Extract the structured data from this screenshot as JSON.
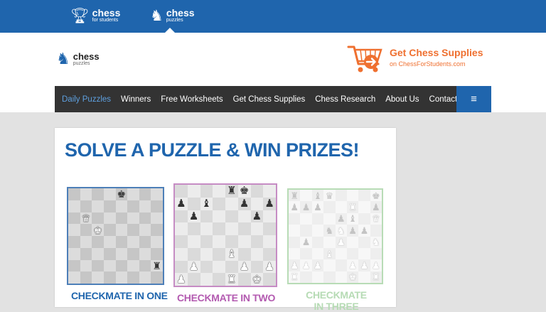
{
  "top_nav": {
    "items": [
      {
        "title": "chess",
        "subtitle": "for students",
        "icon": "trophy-icon"
      },
      {
        "title": "chess",
        "subtitle": "puzzles",
        "icon": "knight-icon"
      }
    ]
  },
  "logo": {
    "title": "chess",
    "subtitle": "puzzles"
  },
  "supplies": {
    "title": "Get Chess Supplies",
    "subtitle": "on ChessForStudents.com"
  },
  "main_nav": {
    "items": [
      "Daily Puzzles",
      "Winners",
      "Free Worksheets",
      "Get Chess Supplies",
      "Chess Research",
      "About Us",
      "Contact"
    ],
    "menu_icon": "≡"
  },
  "headline": "SOLVE A PUZZLE & WIN PRIZES!",
  "puzzles": [
    {
      "label": "CHECKMATE IN ONE",
      "pieces": [
        {
          "sq": "e8",
          "glyph": "♚",
          "color": "black"
        },
        {
          "sq": "b6",
          "glyph": "♛",
          "color": "white"
        },
        {
          "sq": "c5",
          "glyph": "♚",
          "color": "white"
        },
        {
          "sq": "h2",
          "glyph": "♜",
          "color": "black"
        }
      ]
    },
    {
      "label": "CHECKMATE IN TWO",
      "pieces": [
        {
          "sq": "e8",
          "glyph": "♜",
          "color": "black"
        },
        {
          "sq": "f8",
          "glyph": "♚",
          "color": "black"
        },
        {
          "sq": "a7",
          "glyph": "♟",
          "color": "black"
        },
        {
          "sq": "c7",
          "glyph": "♝",
          "color": "black"
        },
        {
          "sq": "f7",
          "glyph": "♟",
          "color": "black"
        },
        {
          "sq": "h7",
          "glyph": "♟",
          "color": "black"
        },
        {
          "sq": "b6",
          "glyph": "♟",
          "color": "black"
        },
        {
          "sq": "g6",
          "glyph": "♟",
          "color": "black"
        },
        {
          "sq": "e3",
          "glyph": "♝",
          "color": "white"
        },
        {
          "sq": "b2",
          "glyph": "♟",
          "color": "white"
        },
        {
          "sq": "f2",
          "glyph": "♟",
          "color": "white"
        },
        {
          "sq": "h2",
          "glyph": "♟",
          "color": "white"
        },
        {
          "sq": "a1",
          "glyph": "♟",
          "color": "white"
        },
        {
          "sq": "e1",
          "glyph": "♜",
          "color": "white"
        },
        {
          "sq": "g1",
          "glyph": "♚",
          "color": "white"
        }
      ]
    },
    {
      "label": "CHECKMATE IN THREE",
      "pieces": [
        {
          "sq": "a8",
          "glyph": "♜",
          "color": "black"
        },
        {
          "sq": "c8",
          "glyph": "♝",
          "color": "black"
        },
        {
          "sq": "d8",
          "glyph": "♛",
          "color": "black"
        },
        {
          "sq": "h8",
          "glyph": "♚",
          "color": "black"
        },
        {
          "sq": "a7",
          "glyph": "♟",
          "color": "black"
        },
        {
          "sq": "b7",
          "glyph": "♟",
          "color": "black"
        },
        {
          "sq": "c7",
          "glyph": "♟",
          "color": "black"
        },
        {
          "sq": "f7",
          "glyph": "♜",
          "color": "white"
        },
        {
          "sq": "h7",
          "glyph": "♟",
          "color": "black"
        },
        {
          "sq": "e6",
          "glyph": "♟",
          "color": "black"
        },
        {
          "sq": "f6",
          "glyph": "♝",
          "color": "black"
        },
        {
          "sq": "h6",
          "glyph": "♛",
          "color": "white"
        },
        {
          "sq": "d5",
          "glyph": "♞",
          "color": "black"
        },
        {
          "sq": "e5",
          "glyph": "♞",
          "color": "white"
        },
        {
          "sq": "f5",
          "glyph": "♟",
          "color": "black"
        },
        {
          "sq": "g5",
          "glyph": "♟",
          "color": "black"
        },
        {
          "sq": "b4",
          "glyph": "♟",
          "color": "black"
        },
        {
          "sq": "e4",
          "glyph": "♟",
          "color": "white"
        },
        {
          "sq": "h4",
          "glyph": "♞",
          "color": "white"
        },
        {
          "sq": "d3",
          "glyph": "♝",
          "color": "white"
        },
        {
          "sq": "c2",
          "glyph": "♟",
          "color": "white"
        },
        {
          "sq": "a2",
          "glyph": "♟",
          "color": "white"
        },
        {
          "sq": "b2",
          "glyph": "♟",
          "color": "white"
        },
        {
          "sq": "f2",
          "glyph": "♟",
          "color": "white"
        },
        {
          "sq": "g2",
          "glyph": "♟",
          "color": "white"
        },
        {
          "sq": "h2",
          "glyph": "♟",
          "color": "white"
        },
        {
          "sq": "a1",
          "glyph": "♜",
          "color": "white"
        },
        {
          "sq": "f1",
          "glyph": "♚",
          "color": "white"
        },
        {
          "sq": "h1",
          "glyph": "♜",
          "color": "white"
        }
      ]
    }
  ],
  "colors": {
    "brand_blue": "#1f65ad",
    "accent_orange": "#ef7030",
    "nav_dark": "#333333",
    "puzzle2": "#b35ab0",
    "puzzle3": "#b6dbb4"
  }
}
